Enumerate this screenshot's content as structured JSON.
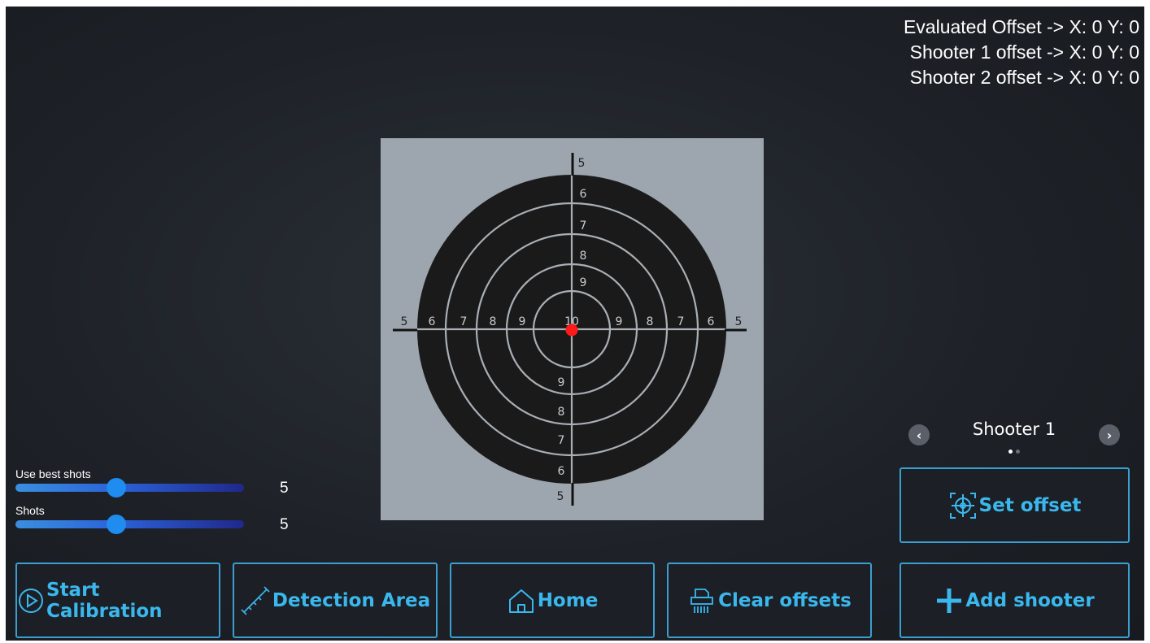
{
  "offsets": {
    "evaluated": "Evaluated Offset -> X: 0 Y: 0",
    "shooter1": "Shooter 1 offset -> X: 0 Y: 0",
    "shooter2": "Shooter 2 offset -> X: 0 Y: 0"
  },
  "target": {
    "ring_numbers": [
      "5",
      "6",
      "7",
      "8",
      "9",
      "10"
    ],
    "hit_color": "#ff1a1a"
  },
  "sliders": {
    "best_shots": {
      "label": "Use best shots",
      "value": "5",
      "fraction": 0.44
    },
    "shots": {
      "label": "Shots",
      "value": "5",
      "fraction": 0.44
    }
  },
  "shooter_nav": {
    "name": "Shooter 1",
    "prev_icon": "chevron-left-icon",
    "next_icon": "chevron-right-icon",
    "page_count": 2,
    "active_page": 1
  },
  "buttons": {
    "start_calibration": "Start Calibration",
    "detection_area": "Detection Area",
    "home": "Home",
    "clear_offsets": "Clear offsets",
    "set_offset": "Set offset",
    "add_shooter": "Add shooter"
  },
  "colors": {
    "accent": "#3ab8ee",
    "button_border": "#3a9fd0",
    "background": "#1e2228",
    "slider_thumb": "#1f8cf0"
  }
}
